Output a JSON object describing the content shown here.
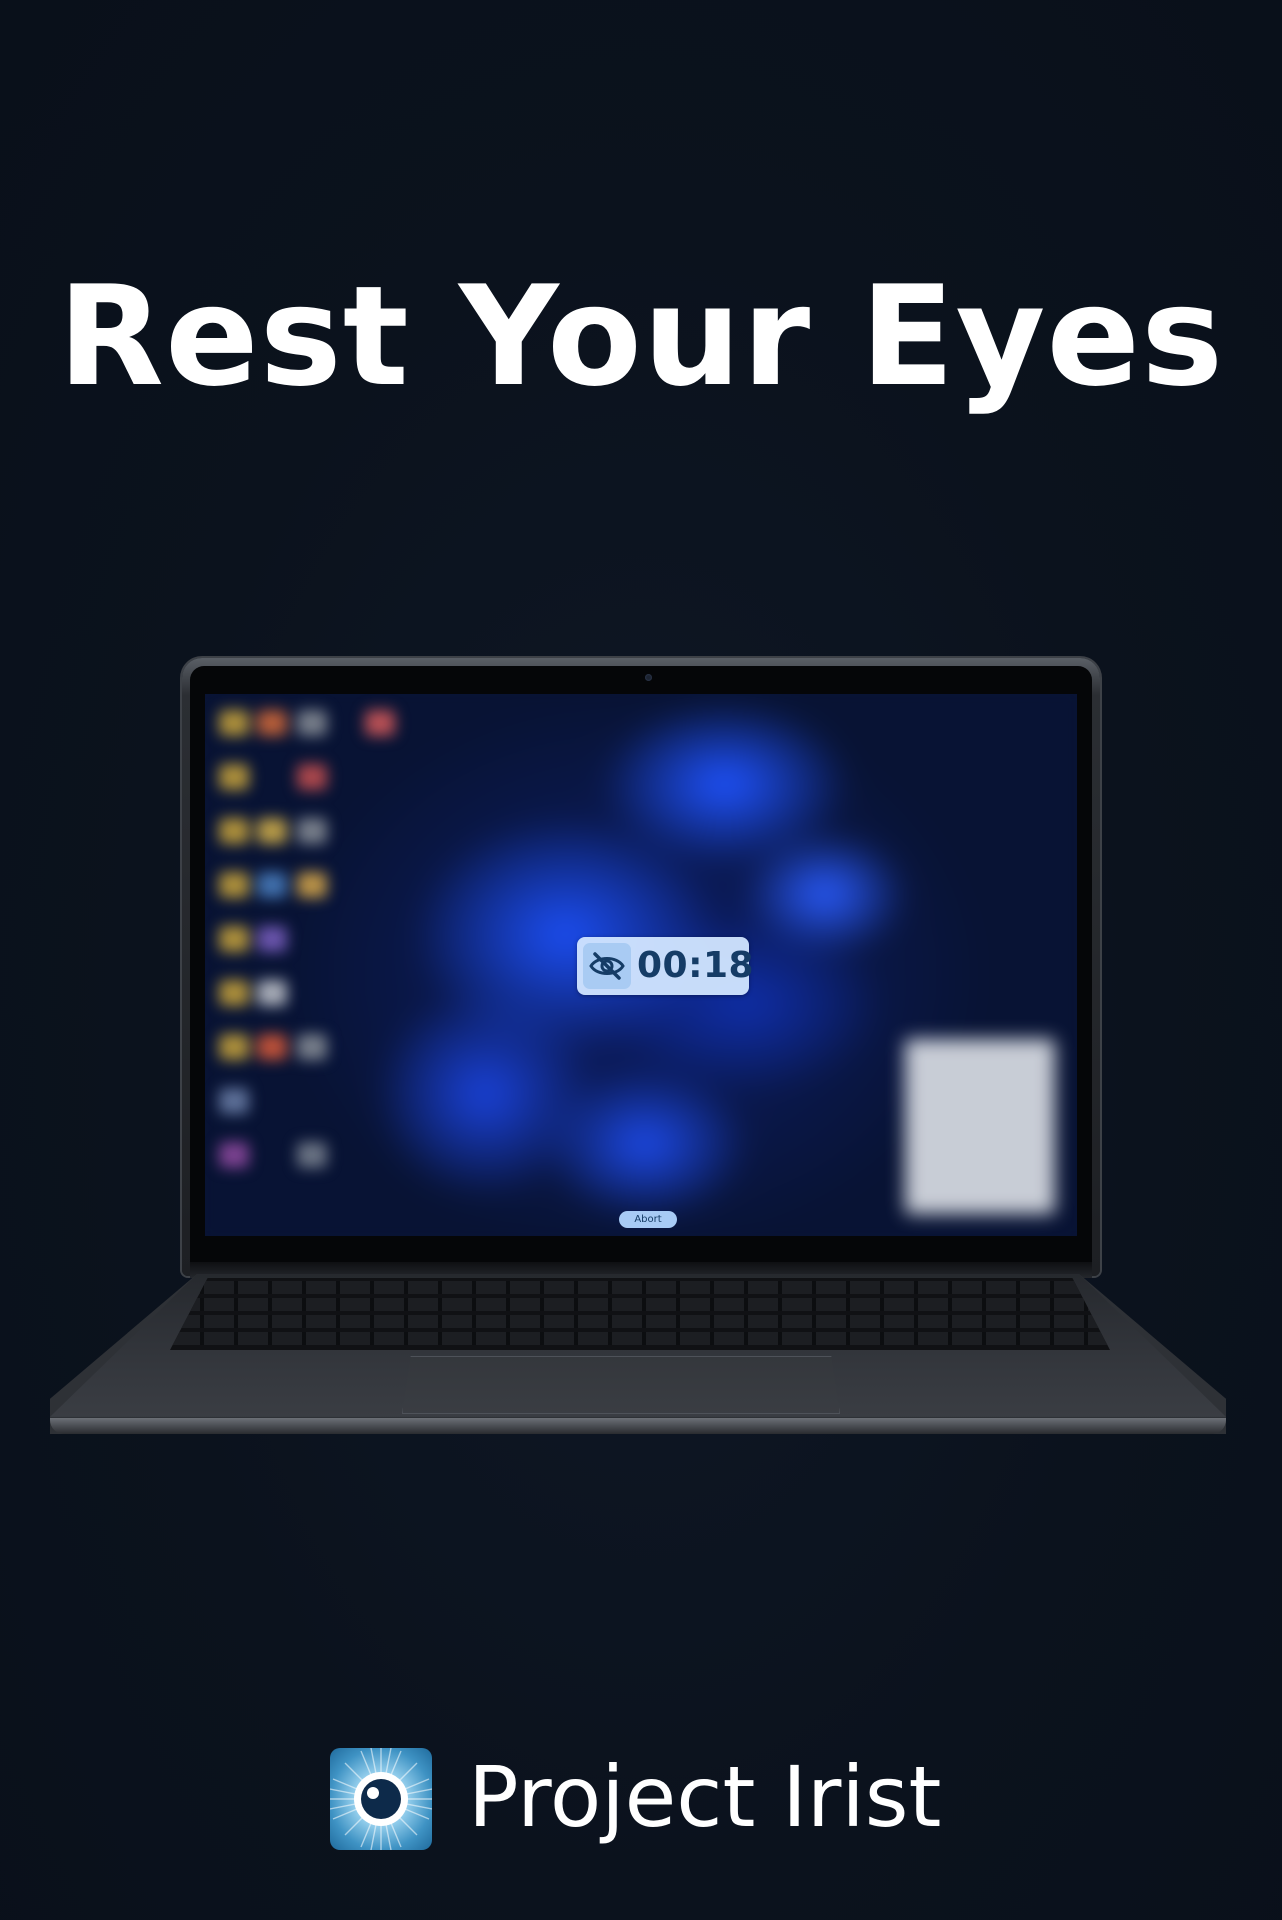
{
  "headline": "Rest Your Eyes",
  "screen": {
    "timer_value": "00:18",
    "timer_icon": "eye-slash-icon",
    "abort_label": "Abort"
  },
  "brand": {
    "name": "Project Irist",
    "logo_icon": "iris-eye-icon"
  },
  "colors": {
    "background": "#0b121d",
    "headline": "#ffffff",
    "timer_pill": "#d2e6ff",
    "timer_text": "#153c66",
    "abort_button": "#a8cbf5",
    "logo_blue": "#3f93c4"
  }
}
